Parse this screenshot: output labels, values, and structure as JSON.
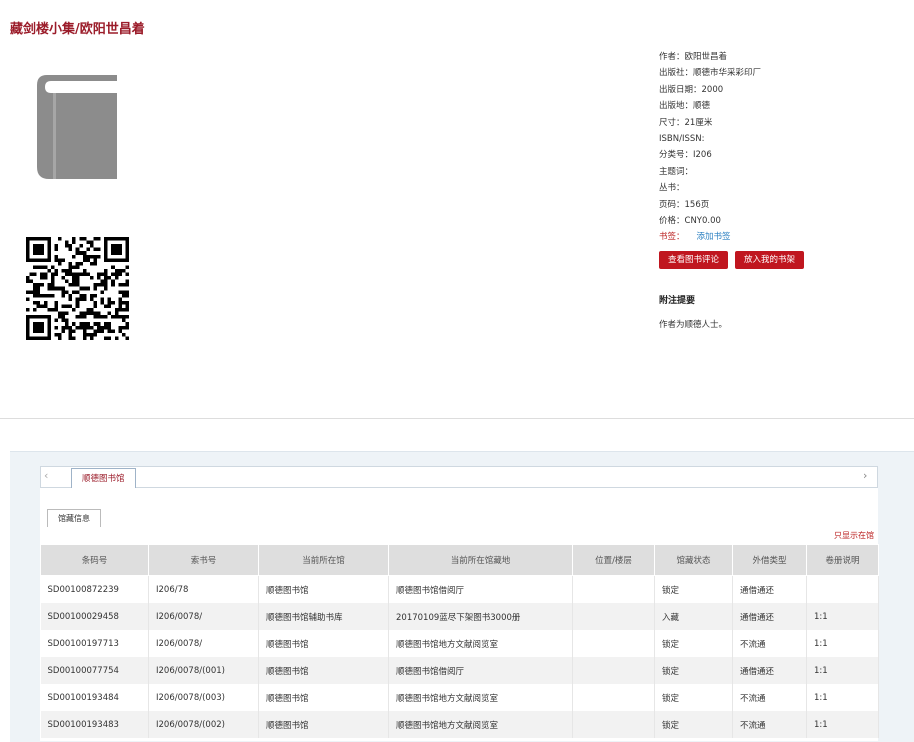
{
  "book": {
    "title": "藏剑楼小集/欧阳世昌着",
    "meta": [
      {
        "label": "作者：",
        "value": "欧阳世昌着"
      },
      {
        "label": "出版社：",
        "value": "顺德市华采彩印厂"
      },
      {
        "label": "出版日期：",
        "value": "2000"
      },
      {
        "label": "出版地：",
        "value": "顺德"
      },
      {
        "label": "尺寸：",
        "value": "21厘米"
      },
      {
        "label": "ISBN/ISSN:",
        "value": ""
      },
      {
        "label": "分类号：",
        "value": "I206"
      },
      {
        "label": "主题词：",
        "value": ""
      },
      {
        "label": "丛书：",
        "value": ""
      },
      {
        "label": "页码：",
        "value": "156页"
      },
      {
        "label": "价格：",
        "value": "CNY0.00"
      }
    ],
    "tags_label": "书签：",
    "add_tag_link": "添加书签",
    "btn_view_reviews": "查看图书评论",
    "btn_add_shelf": "放入我的书架",
    "abstract_title": "附注提要",
    "abstract_text": "作者为顺德人士。"
  },
  "holdings": {
    "library_tab": "顺德图书馆",
    "holding_tab": "馆藏信息",
    "show_only": "只显示在馆",
    "columns": [
      "条码号",
      "索书号",
      "当前所在馆",
      "当前所在馆藏地",
      "位置/楼层",
      "馆藏状态",
      "外借类型",
      "卷册说明"
    ],
    "rows": [
      [
        "SD00100872239",
        "I206/78",
        "顺德图书馆",
        "顺德图书馆借阅厅",
        "",
        "锁定",
        "通借通还",
        ""
      ],
      [
        "SD00100029458",
        "I206/0078/",
        "顺德图书馆辅助书库",
        "20170109蓝尽下架图书3000册",
        "",
        "入藏",
        "通借通还",
        "1:1"
      ],
      [
        "SD00100197713",
        "I206/0078/",
        "顺德图书馆",
        "顺德图书馆地方文献阅览室",
        "",
        "锁定",
        "不流通",
        "1:1"
      ],
      [
        "SD00100077754",
        "I206/0078/(001)",
        "顺德图书馆",
        "顺德图书馆借阅厅",
        "",
        "锁定",
        "通借通还",
        "1:1"
      ],
      [
        "SD00100193484",
        "I206/0078/(003)",
        "顺德图书馆",
        "顺德图书馆地方文献阅览室",
        "",
        "锁定",
        "不流通",
        "1:1"
      ],
      [
        "SD00100193483",
        "I206/0078/(002)",
        "顺德图书馆",
        "顺德图书馆地方文献阅览室",
        "",
        "锁定",
        "不流通",
        "1:1"
      ]
    ]
  },
  "icons": {
    "book": "book-icon",
    "qr": "qr-code-icon",
    "prev": "chevron-left-icon",
    "next": "chevron-right-icon"
  },
  "colors": {
    "accent": "#c0161f",
    "title": "#9b1c2a",
    "link": "#2a7fc1"
  }
}
